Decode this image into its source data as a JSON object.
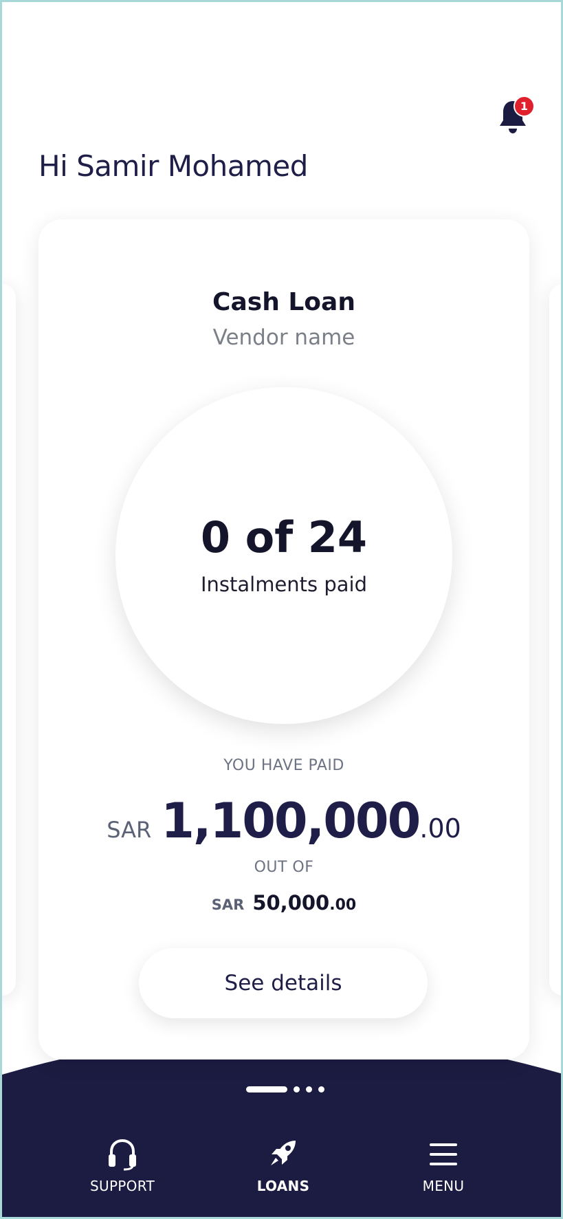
{
  "header": {
    "notification_count": "1",
    "greeting": "Hi Samir Mohamed"
  },
  "loan_card": {
    "title": "Cash Loan",
    "vendor": "Vendor name",
    "instalments": {
      "count_text": "0 of 24",
      "paid": 0,
      "total": 24,
      "label": "Instalments paid"
    },
    "paid_caption": "YOU HAVE PAID",
    "paid_amount": {
      "currency": "SAR",
      "whole": "1,100,000",
      "decimal": ".00"
    },
    "outof_caption": "OUT OF",
    "total_amount": {
      "currency": "SAR",
      "whole": "50,000",
      "decimal": ".00"
    },
    "details_button_label": "See details"
  },
  "carousel": {
    "page_count": 4,
    "active_index": 0
  },
  "bottom_nav": {
    "background_color": "#1c1c42",
    "items": [
      {
        "label": "SUPPORT",
        "icon": "headset-icon",
        "active": false
      },
      {
        "label": "LOANS",
        "icon": "rocket-icon",
        "active": true
      },
      {
        "label": "MENU",
        "icon": "hamburger-menu-icon",
        "active": false
      }
    ]
  },
  "colors": {
    "primary_navy": "#1c1c42",
    "badge_red": "#e0202c",
    "muted_text": "#7b8088"
  }
}
